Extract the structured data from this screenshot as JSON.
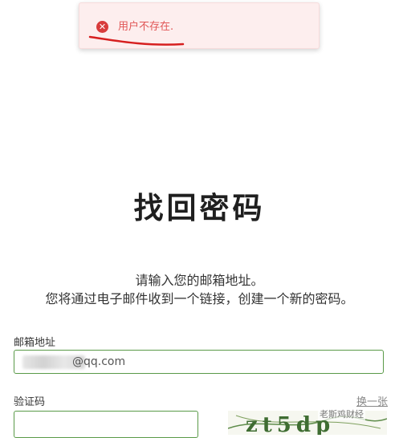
{
  "toast": {
    "message": "用户不存在.",
    "icon": "error-circle-icon",
    "accent": "#d83c3c"
  },
  "page": {
    "title": "找回密码",
    "desc_line1": "请输入您的邮箱地址。",
    "desc_line2": "您将通过电子邮件收到一个链接，创建一个新的密码。"
  },
  "form": {
    "email_label": "邮箱地址",
    "email_value_suffix": "@qq.com",
    "captcha_label": "验证码",
    "captcha_value": "",
    "refresh_label": "换一张",
    "captcha_text": "zt5dp",
    "border_color": "#5a9a48"
  },
  "watermark": "老斯鸡财经"
}
